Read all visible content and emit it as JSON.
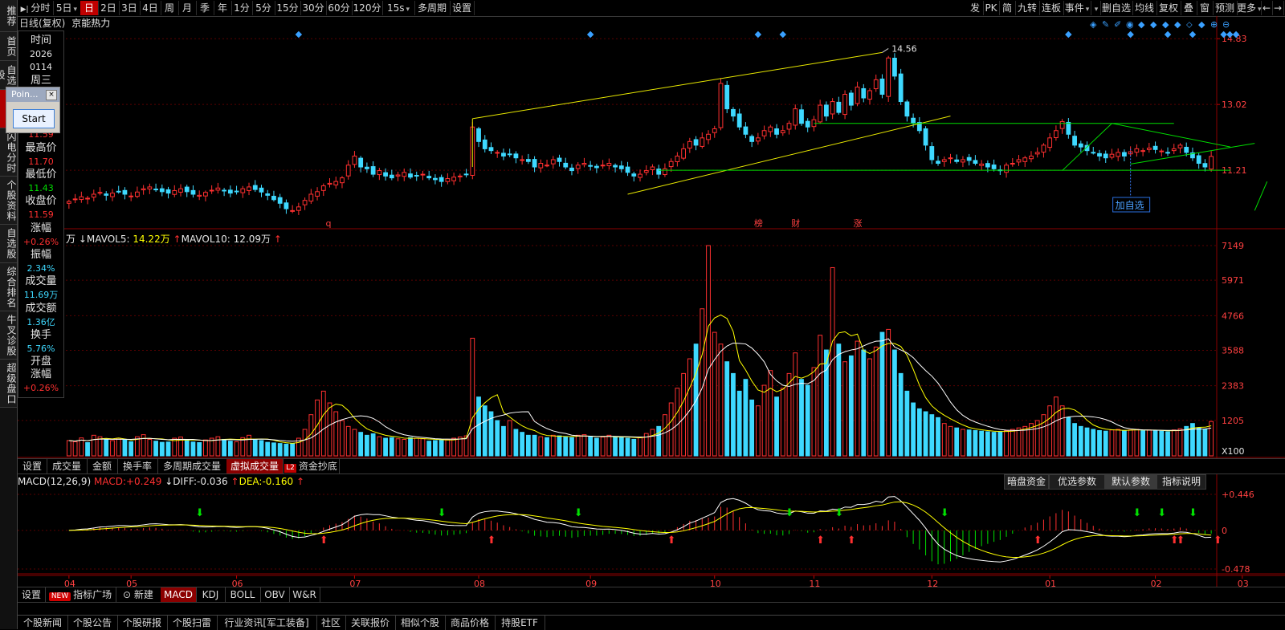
{
  "toolbar": {
    "left_items": [
      {
        "label": "分时",
        "w": 44,
        "icon": "play-bar"
      },
      {
        "label": "5日",
        "w": 34,
        "dd": true
      },
      {
        "label": "日",
        "w": 22,
        "active": true
      },
      {
        "label": "2日",
        "w": 26
      },
      {
        "label": "3日",
        "w": 26
      },
      {
        "label": "4日",
        "w": 26
      },
      {
        "label": "周",
        "w": 22
      },
      {
        "label": "月",
        "w": 22
      },
      {
        "label": "季",
        "w": 22
      },
      {
        "label": "年",
        "w": 22
      },
      {
        "label": "1分",
        "w": 26
      },
      {
        "label": "5分",
        "w": 28
      },
      {
        "label": "15分",
        "w": 32
      },
      {
        "label": "30分",
        "w": 32
      },
      {
        "label": "60分",
        "w": 32
      },
      {
        "label": "120分",
        "w": 38
      },
      {
        "label": "15s",
        "w": 40,
        "dd": true
      },
      {
        "label": "多周期",
        "w": 44
      },
      {
        "label": "设置",
        "w": 30
      }
    ],
    "right_items": [
      {
        "label": "发",
        "w": 20
      },
      {
        "label": "PK",
        "w": 20
      },
      {
        "label": "简",
        "w": 20
      },
      {
        "label": "九转",
        "w": 30
      },
      {
        "label": "连板",
        "w": 30
      },
      {
        "label": "事件",
        "w": 34,
        "dd": true
      },
      {
        "label": "",
        "w": 12,
        "dd": true
      },
      {
        "label": "删自选",
        "w": 40
      },
      {
        "label": "均线",
        "w": 30
      },
      {
        "label": "复权",
        "w": 30
      },
      {
        "label": "叠",
        "w": 20
      },
      {
        "label": "窗",
        "w": 20
      },
      {
        "label": "预测",
        "w": 30
      },
      {
        "label": "更多",
        "w": 30,
        "dd": true
      },
      {
        "label": "←",
        "w": 14
      },
      {
        "label": "→",
        "w": 14
      }
    ]
  },
  "leftnav": [
    {
      "label": "推荐",
      "h": 40
    },
    {
      "label": "首页",
      "h": 36
    },
    {
      "label": "自选股",
      "h": 36
    },
    {
      "label": "K线图",
      "h": 48,
      "active": true
    },
    {
      "label": "闪电分时",
      "h": 60
    },
    {
      "label": "个股资料",
      "h": 60
    },
    {
      "label": "自选股",
      "h": 48
    },
    {
      "label": "综合排名",
      "h": 60
    },
    {
      "label": "牛叉诊股",
      "h": 60
    },
    {
      "label": "超级盘口",
      "h": 60
    }
  ],
  "chart_header": {
    "title": "日线(复权)",
    "stock_name": "京能热力"
  },
  "info_panel": {
    "time_label": "时间",
    "year": "2026",
    "date": "0114",
    "weekday": "周三",
    "hidden_value": "11.59",
    "high_label": "最高价",
    "high_value": "11.70",
    "low_label": "最低价",
    "low_value": "11.43",
    "close_label": "收盘价",
    "close_value": "11.59",
    "change_label": "涨幅",
    "change_value": "+0.26%",
    "amplitude_label": "振幅",
    "amplitude_value": "2.34%",
    "volume_label": "成交量",
    "volume_value": "11.69万",
    "amount_label": "成交额",
    "amount_value": "1.36亿",
    "turnover_label": "换手",
    "turnover_value": "5.76%",
    "open_label": "开盘",
    "open_change_label": "涨幅",
    "open_change_value": "+0.26%"
  },
  "point_window": {
    "title": "Poin...",
    "close": "×",
    "button": "Start"
  },
  "price_axis": [
    "14.83",
    "13.02",
    "11.21"
  ],
  "price_annotations": {
    "peak": "14.56",
    "markers": [
      "q",
      "榜",
      "财",
      "涨"
    ],
    "add_tag": "加自选"
  },
  "volume_header": {
    "lead": "万",
    "mavol5_label": "MAVOL5:",
    "mavol5_value": "14.22万",
    "mavol10_label": "MAVOL10:",
    "mavol10_value": "12.09万"
  },
  "volume_axis": [
    "7149",
    "5971",
    "4766",
    "3588",
    "2383",
    "1205",
    "X100"
  ],
  "volume_tabs": [
    "设置",
    "成交量",
    "金额",
    "换手率",
    "多周期成交量",
    "虚拟成交量",
    "资金抄底"
  ],
  "volume_tab_badge": "L2",
  "macd_header": {
    "name": "MACD(12,26,9)",
    "macd_label": "MACD:",
    "macd_value": "+0.249",
    "diff_label": "DIFF:",
    "diff_value": "-0.036",
    "dea_label": "DEA:",
    "dea_value": "-0.160"
  },
  "macd_buttons": [
    "暗盘资金",
    "优选参数",
    "默认参数",
    "指标说明"
  ],
  "macd_axis": [
    "+0.446",
    "0",
    "-0.478"
  ],
  "x_axis": [
    "04",
    "05",
    "06",
    "07",
    "08",
    "09",
    "10",
    "11",
    "12",
    "01",
    "02",
    "03"
  ],
  "indicator_tabs": [
    "设置",
    "指标广场",
    "新建",
    "MACD",
    "KDJ",
    "BOLL",
    "OBV",
    "W&R"
  ],
  "indicator_new_badge": "NEW",
  "bottom_tabs": [
    "个股新闻",
    "个股公告",
    "个股研报",
    "个股扫雷",
    "行业资讯[军工装备]",
    "社区",
    "关联报价",
    "相似个股",
    "商品价格",
    "持股ETF"
  ],
  "colors": {
    "up": "#ff3030",
    "down": "#3ed9ff",
    "ma5": "#ffff00",
    "ma10": "#ffffff",
    "trend": "#e8e800",
    "channel": "#00dd00"
  },
  "chart_data": {
    "type": "candlestick",
    "title": "京能热力 日线(复权)",
    "x_ticks": [
      "04",
      "05",
      "06",
      "07",
      "08",
      "09",
      "10",
      "11",
      "12",
      "01",
      "02",
      "03"
    ],
    "price_axis_ticks": [
      11.21,
      13.02,
      14.83
    ],
    "ylim": [
      9.6,
      15.1
    ],
    "peak_price": 14.56,
    "volume_axis_ticks_x100": [
      1205,
      2383,
      3588,
      4766,
      5971,
      7149
    ],
    "macd_axis_ticks": [
      -0.478,
      0,
      0.446
    ],
    "closes": [
      10.35,
      10.42,
      10.48,
      10.44,
      10.55,
      10.6,
      10.52,
      10.58,
      10.63,
      10.55,
      10.5,
      10.61,
      10.7,
      10.75,
      10.68,
      10.62,
      10.58,
      10.65,
      10.7,
      10.62,
      10.55,
      10.52,
      10.6,
      10.66,
      10.72,
      10.65,
      10.58,
      10.62,
      10.7,
      10.75,
      10.68,
      10.61,
      10.52,
      10.4,
      10.3,
      10.15,
      10.1,
      10.2,
      10.38,
      10.55,
      10.62,
      10.78,
      10.85,
      10.9,
      11.0,
      11.35,
      11.6,
      11.3,
      11.25,
      11.1,
      11.2,
      11.05,
      11.0,
      11.08,
      11.15,
      11.02,
      11.05,
      11.1,
      11.0,
      10.95,
      10.9,
      10.98,
      11.02,
      11.05,
      11.1,
      12.4,
      12.0,
      11.8,
      11.75,
      11.7,
      11.6,
      11.65,
      11.55,
      11.5,
      11.45,
      11.3,
      11.4,
      11.35,
      11.5,
      11.45,
      11.3,
      11.2,
      11.35,
      11.4,
      11.32,
      11.28,
      11.35,
      11.4,
      11.3,
      11.25,
      11.15,
      11.05,
      11.1,
      11.2,
      11.3,
      11.1,
      11.25,
      11.45,
      11.6,
      11.8,
      12.0,
      11.9,
      12.1,
      12.2,
      12.35,
      13.6,
      12.9,
      12.7,
      12.4,
      12.2,
      12.0,
      12.1,
      12.3,
      12.4,
      12.2,
      12.3,
      12.5,
      12.9,
      12.5,
      12.4,
      12.6,
      13.0,
      12.7,
      13.1,
      12.8,
      13.3,
      13.0,
      13.5,
      13.2,
      13.4,
      13.7,
      13.3,
      14.3,
      13.8,
      13.1,
      12.7,
      12.5,
      12.3,
      11.9,
      11.5,
      11.4,
      11.5,
      11.55,
      11.45,
      11.5,
      11.48,
      11.4,
      11.38,
      11.3,
      11.25,
      11.2,
      11.35,
      11.4,
      11.5,
      11.55,
      11.6,
      11.7,
      11.9,
      12.1,
      12.3,
      12.55,
      12.2,
      11.9,
      11.85,
      11.75,
      11.7,
      11.6,
      11.55,
      11.65,
      11.7,
      11.6,
      11.72,
      11.8,
      11.75,
      11.82,
      11.78,
      11.74,
      11.7,
      11.8,
      11.9,
      11.7,
      11.55,
      11.4,
      11.3,
      11.59
    ],
    "volumes_x100": [
      520,
      480,
      610,
      450,
      700,
      650,
      560,
      520,
      600,
      540,
      480,
      650,
      720,
      560,
      500,
      460,
      470,
      600,
      640,
      520,
      470,
      450,
      540,
      600,
      650,
      560,
      500,
      480,
      620,
      700,
      540,
      520,
      460,
      440,
      420,
      400,
      410,
      600,
      900,
      1400,
      1900,
      2200,
      1800,
      1500,
      1200,
      1000,
      900,
      800,
      700,
      750,
      650,
      600,
      620,
      580,
      560,
      620,
      600,
      580,
      500,
      520,
      540,
      560,
      600,
      640,
      680,
      4000,
      2000,
      1700,
      1500,
      1200,
      1000,
      1200,
      900,
      800,
      700,
      700,
      650,
      620,
      700,
      680,
      650,
      620,
      700,
      720,
      650,
      600,
      640,
      700,
      650,
      620,
      600,
      560,
      640,
      760,
      900,
      1000,
      1400,
      1800,
      2300,
      2800,
      3300,
      3800,
      5000,
      7149,
      4200,
      3800,
      3200,
      2800,
      2200,
      2600,
      1900,
      1700,
      2400,
      2900,
      2000,
      2300,
      2800,
      3500,
      2600,
      2400,
      3000,
      4100,
      3600,
      6400,
      3800,
      3200,
      3400,
      3900,
      3600,
      3300,
      3700,
      4200,
      4300,
      3600,
      2800,
      2200,
      1800,
      1600,
      1500,
      1400,
      1300,
      1100,
      1000,
      950,
      900,
      880,
      860,
      840,
      820,
      800,
      820,
      860,
      900,
      950,
      1000,
      1100,
      1200,
      1400,
      1700,
      2000,
      1700,
      1300,
      1100,
      1000,
      950,
      900,
      860,
      840,
      880,
      900,
      860,
      880,
      900,
      860,
      880,
      860,
      840,
      820,
      880,
      920,
      1000,
      1100,
      950,
      900,
      1169
    ],
    "series": [
      {
        "name": "MAVOL5",
        "value": "14.22万"
      },
      {
        "name": "MAVOL10",
        "value": "12.09万"
      }
    ]
  }
}
